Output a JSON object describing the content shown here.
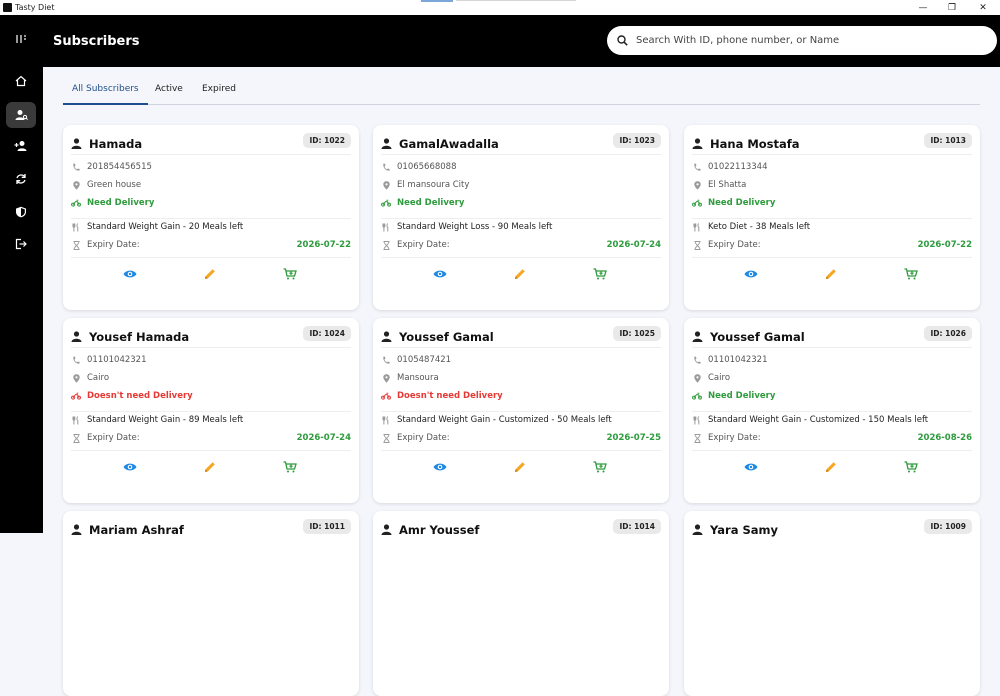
{
  "window": {
    "title": "Tasty Diet",
    "minimize": "—",
    "maximize": "❐",
    "close": "✕"
  },
  "header": {
    "title": "Subscribers"
  },
  "search": {
    "placeholder": "Search With ID, phone number, or Name"
  },
  "tabs": [
    {
      "label": "All Subscribers",
      "active": true
    },
    {
      "label": "Active",
      "active": false
    },
    {
      "label": "Expired",
      "active": false
    }
  ],
  "colors": {
    "green": "#2e9b3d",
    "red": "#e53935",
    "blue": "#1e88e5",
    "orange": "#f5a623"
  },
  "sidebar": {
    "items": [
      "menu-icon",
      "home-icon",
      "subscribers-icon",
      "add-user-icon",
      "renew-icon",
      "shield-icon",
      "logout-icon"
    ]
  },
  "labels": {
    "expiry": "Expiry Date:"
  },
  "cards": [
    {
      "name": "Hamada",
      "id": "ID: 1022",
      "phone": "201854456515",
      "address": "Green house",
      "delivery": "Need Delivery",
      "need": true,
      "plan": "Standard Weight Gain - 20 Meals left",
      "expiry": "2026-07-22"
    },
    {
      "name": "GamalAwadalla",
      "id": "ID: 1023",
      "phone": "01065668088",
      "address": "El mansoura City",
      "delivery": "Need Delivery",
      "need": true,
      "plan": "Standard Weight Loss - 90 Meals left",
      "expiry": "2026-07-24"
    },
    {
      "name": "Hana Mostafa",
      "id": "ID: 1013",
      "phone": "01022113344",
      "address": "El Shatta",
      "delivery": "Need Delivery",
      "need": true,
      "plan": "Keto Diet - 38 Meals left",
      "expiry": "2026-07-22"
    },
    {
      "name": "Yousef Hamada",
      "id": "ID: 1024",
      "phone": "01101042321",
      "address": "Cairo",
      "delivery": "Doesn't need Delivery",
      "need": false,
      "plan": "Standard Weight Gain - 89 Meals left",
      "expiry": "2026-07-24"
    },
    {
      "name": "Youssef Gamal",
      "id": "ID: 1025",
      "phone": "0105487421",
      "address": "Mansoura",
      "delivery": "Doesn't need Delivery",
      "need": false,
      "plan": "Standard Weight Gain - Customized - 50 Meals left",
      "expiry": "2026-07-25"
    },
    {
      "name": "Youssef Gamal",
      "id": "ID: 1026",
      "phone": "01101042321",
      "address": "Cairo",
      "delivery": "Need Delivery",
      "need": true,
      "plan": "Standard Weight Gain - Customized - 150 Meals left",
      "expiry": "2026-08-26"
    },
    {
      "name": "Mariam Ashraf",
      "id": "ID: 1011"
    },
    {
      "name": "Amr Youssef",
      "id": "ID: 1014"
    },
    {
      "name": "Yara Samy",
      "id": "ID: 1009"
    }
  ]
}
